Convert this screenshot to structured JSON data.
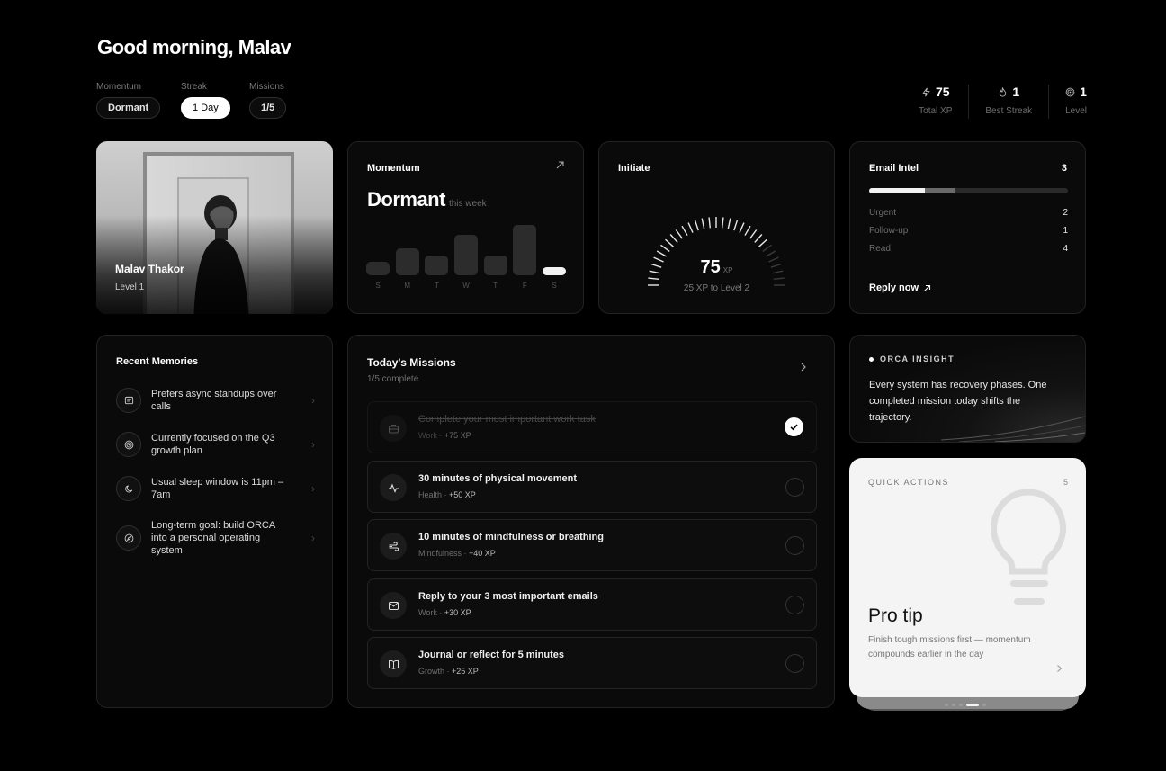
{
  "greeting": "Good morning, Malav",
  "status": {
    "momentum_label": "Momentum",
    "momentum_value": "Dormant",
    "streak_label": "Streak",
    "streak_value": "1 Day",
    "missions_label": "Missions",
    "missions_value": "1/5"
  },
  "stats": [
    {
      "icon": "bolt-icon",
      "value": "75",
      "label": "Total XP"
    },
    {
      "icon": "flame-icon",
      "value": "1",
      "label": "Best Streak"
    },
    {
      "icon": "target-icon",
      "value": "1",
      "label": "Level"
    }
  ],
  "profile": {
    "name": "Malav Thakor",
    "level": "Level 1"
  },
  "momentum": {
    "title": "Momentum",
    "value": "Dormant",
    "sub": "this week",
    "chart_data": {
      "type": "bar",
      "categories": [
        "S",
        "M",
        "T",
        "W",
        "T",
        "F",
        "S"
      ],
      "values": [
        2,
        4,
        3,
        6,
        3,
        7.5,
        1
      ],
      "ylim": [
        0,
        8
      ],
      "highlight_index": 6
    }
  },
  "initiate": {
    "title": "Initiate",
    "xp": "75",
    "unit": "XP",
    "sub": "25 XP to Level 2",
    "progress": 0.75
  },
  "email": {
    "title": "Email Intel",
    "count": "3",
    "bar_primary": 0.28,
    "bar_secondary": 0.15,
    "rows": [
      {
        "label": "Urgent",
        "value": "2"
      },
      {
        "label": "Follow-up",
        "value": "1"
      },
      {
        "label": "Read",
        "value": "4"
      }
    ],
    "reply": "Reply now"
  },
  "memories": {
    "title": "Recent Memories",
    "items": [
      {
        "icon": "message-icon",
        "text": "Prefers async standups over calls"
      },
      {
        "icon": "target-icon",
        "text": "Currently focused on the Q3 growth plan"
      },
      {
        "icon": "moon-icon",
        "text": "Usual sleep window is 11pm – 7am"
      },
      {
        "icon": "compass-icon",
        "text": "Long-term goal: build ORCA into a personal operating system"
      }
    ]
  },
  "missions": {
    "title": "Today's Missions",
    "sub": "1/5 complete",
    "items": [
      {
        "icon": "briefcase-icon",
        "title": "Complete your most important work task",
        "category": "Work",
        "xp": "+75 XP",
        "done": true
      },
      {
        "icon": "activity-icon",
        "title": "30 minutes of physical movement",
        "category": "Health",
        "xp": "+50 XP",
        "done": false
      },
      {
        "icon": "wind-icon",
        "title": "10 minutes of mindfulness or breathing",
        "category": "Mindfulness",
        "xp": "+40 XP",
        "done": false
      },
      {
        "icon": "mail-icon",
        "title": "Reply to your 3 most important emails",
        "category": "Work",
        "xp": "+30 XP",
        "done": false
      },
      {
        "icon": "book-icon",
        "title": "Journal or reflect for 5 minutes",
        "category": "Growth",
        "xp": "+25 XP",
        "done": false
      }
    ]
  },
  "insight": {
    "label": "ORCA INSIGHT",
    "text": "Every system has recovery phases. One completed mission today shifts the trajectory."
  },
  "quick_actions": {
    "label": "QUICK ACTIONS",
    "count": "5",
    "title": "Pro tip",
    "text": "Finish tough missions first — momentum compounds earlier in the day"
  }
}
